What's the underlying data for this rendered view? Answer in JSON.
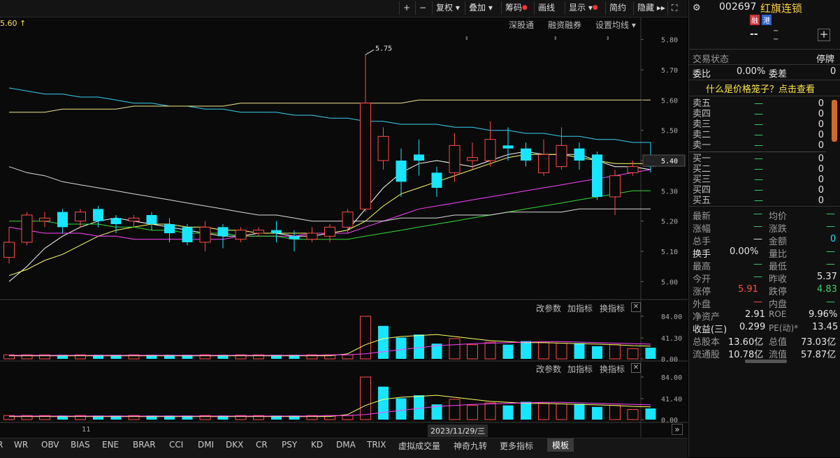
{
  "toolbar": {
    "plus": "+",
    "minus": "−",
    "fuquan": "复权",
    "diejia": "叠加",
    "chouma": "筹码",
    "huaxian": "画线",
    "xianshi": "显示",
    "jianyue": "简约",
    "yincang": "隐藏",
    "expand": "⛶"
  },
  "chart_header": {
    "price_tag": "5.60",
    "up_arrow": "↑",
    "links": [
      "深股通",
      "融资融券",
      "设置均线"
    ]
  },
  "chart_data": [
    {
      "type": "candlestick",
      "ylim": [
        4.95,
        5.85
      ],
      "yticks": [
        "5.80",
        "5.70",
        "5.60",
        "5.50",
        "5.40",
        "5.30",
        "5.20",
        "5.10",
        "5.00"
      ],
      "high_annotation": "5.75",
      "current_price": "5.40",
      "candles": [
        {
          "o": 5.08,
          "c": 5.13,
          "h": 5.18,
          "l": 5.06
        },
        {
          "o": 5.13,
          "c": 5.22,
          "h": 5.23,
          "l": 5.12
        },
        {
          "o": 5.2,
          "c": 5.21,
          "h": 5.23,
          "l": 5.18
        },
        {
          "o": 5.23,
          "c": 5.18,
          "h": 5.24,
          "l": 5.16
        },
        {
          "o": 5.2,
          "c": 5.23,
          "h": 5.24,
          "l": 5.18
        },
        {
          "o": 5.24,
          "c": 5.2,
          "h": 5.25,
          "l": 5.18
        },
        {
          "o": 5.21,
          "c": 5.19,
          "h": 5.22,
          "l": 5.16
        },
        {
          "o": 5.2,
          "c": 5.21,
          "h": 5.22,
          "l": 5.18
        },
        {
          "o": 5.22,
          "c": 5.19,
          "h": 5.23,
          "l": 5.17
        },
        {
          "o": 5.19,
          "c": 5.16,
          "h": 5.21,
          "l": 5.13
        },
        {
          "o": 5.18,
          "c": 5.13,
          "h": 5.19,
          "l": 5.12
        },
        {
          "o": 5.13,
          "c": 5.18,
          "h": 5.2,
          "l": 5.1
        },
        {
          "o": 5.18,
          "c": 5.15,
          "h": 5.19,
          "l": 5.11
        },
        {
          "o": 5.14,
          "c": 5.17,
          "h": 5.18,
          "l": 5.13
        },
        {
          "o": 5.16,
          "c": 5.17,
          "h": 5.18,
          "l": 5.15
        },
        {
          "o": 5.17,
          "c": 5.16,
          "h": 5.2,
          "l": 5.13
        },
        {
          "o": 5.15,
          "c": 5.14,
          "h": 5.17,
          "l": 5.1
        },
        {
          "o": 5.14,
          "c": 5.16,
          "h": 5.18,
          "l": 5.13
        },
        {
          "o": 5.15,
          "c": 5.18,
          "h": 5.19,
          "l": 5.13
        },
        {
          "o": 5.18,
          "c": 5.23,
          "h": 5.24,
          "l": 5.16
        },
        {
          "o": 5.24,
          "c": 5.59,
          "h": 5.75,
          "l": 5.23
        },
        {
          "o": 5.4,
          "c": 5.48,
          "h": 5.51,
          "l": 5.37
        },
        {
          "o": 5.4,
          "c": 5.33,
          "h": 5.44,
          "l": 5.28
        },
        {
          "o": 5.42,
          "c": 5.4,
          "h": 5.47,
          "l": 5.35
        },
        {
          "o": 5.36,
          "c": 5.31,
          "h": 5.38,
          "l": 5.28
        },
        {
          "o": 5.36,
          "c": 5.45,
          "h": 5.49,
          "l": 5.33
        },
        {
          "o": 5.4,
          "c": 5.41,
          "h": 5.46,
          "l": 5.37
        },
        {
          "o": 5.4,
          "c": 5.47,
          "h": 5.53,
          "l": 5.38
        },
        {
          "o": 5.45,
          "c": 5.44,
          "h": 5.51,
          "l": 5.4
        },
        {
          "o": 5.44,
          "c": 5.4,
          "h": 5.46,
          "l": 5.38
        },
        {
          "o": 5.36,
          "c": 5.42,
          "h": 5.47,
          "l": 5.35
        },
        {
          "o": 5.38,
          "c": 5.45,
          "h": 5.51,
          "l": 5.37
        },
        {
          "o": 5.44,
          "c": 5.4,
          "h": 5.46,
          "l": 5.37
        },
        {
          "o": 5.42,
          "c": 5.28,
          "h": 5.43,
          "l": 5.27
        },
        {
          "o": 5.28,
          "c": 5.35,
          "h": 5.37,
          "l": 5.22
        },
        {
          "o": 5.36,
          "c": 5.38,
          "h": 5.4,
          "l": 5.35
        },
        {
          "o": 5.41,
          "c": 5.38,
          "h": 5.46,
          "l": 5.36
        }
      ],
      "ma_lines": [
        {
          "color": "#ffffff",
          "values": [
            5.0,
            5.05,
            5.11,
            5.15,
            5.18,
            5.2,
            5.21,
            5.2,
            5.19,
            5.18,
            5.17,
            5.16,
            5.15,
            5.15,
            5.16,
            5.16,
            5.15,
            5.15,
            5.16,
            5.17,
            5.24,
            5.31,
            5.36,
            5.39,
            5.4,
            5.39,
            5.38,
            5.4,
            5.42,
            5.43,
            5.42,
            5.42,
            5.42,
            5.4,
            5.38,
            5.38,
            5.37
          ]
        },
        {
          "color": "#ffff66",
          "values": [
            5.02,
            5.04,
            5.07,
            5.09,
            5.12,
            5.15,
            5.17,
            5.18,
            5.19,
            5.19,
            5.18,
            5.18,
            5.17,
            5.17,
            5.16,
            5.16,
            5.16,
            5.16,
            5.16,
            5.17,
            5.2,
            5.25,
            5.29,
            5.31,
            5.33,
            5.35,
            5.37,
            5.39,
            5.41,
            5.42,
            5.42,
            5.42,
            5.41,
            5.4,
            5.39,
            5.39,
            5.39
          ]
        },
        {
          "color": "#ff44ff",
          "values": [
            5.18,
            5.17,
            5.16,
            5.16,
            5.16,
            5.15,
            5.15,
            5.14,
            5.14,
            5.14,
            5.14,
            5.14,
            5.14,
            5.15,
            5.15,
            5.15,
            5.15,
            5.16,
            5.16,
            5.16,
            5.18,
            5.2,
            5.22,
            5.24,
            5.25,
            5.26,
            5.27,
            5.28,
            5.29,
            5.3,
            5.31,
            5.32,
            5.33,
            5.34,
            5.35,
            5.36,
            5.37
          ]
        },
        {
          "color": "#33dd33",
          "values": [
            5.2,
            5.2,
            5.2,
            5.19,
            5.19,
            5.19,
            5.18,
            5.18,
            5.17,
            5.17,
            5.16,
            5.16,
            5.16,
            5.15,
            5.15,
            5.15,
            5.14,
            5.14,
            5.14,
            5.14,
            5.15,
            5.16,
            5.17,
            5.18,
            5.19,
            5.2,
            5.21,
            5.22,
            5.23,
            5.24,
            5.25,
            5.26,
            5.27,
            5.28,
            5.29,
            5.3,
            5.3
          ]
        },
        {
          "color": "#dddddd",
          "values": [
            5.38,
            5.36,
            5.35,
            5.33,
            5.32,
            5.31,
            5.3,
            5.29,
            5.28,
            5.27,
            5.26,
            5.25,
            5.24,
            5.23,
            5.22,
            5.22,
            5.21,
            5.2,
            5.2,
            5.2,
            5.2,
            5.2,
            5.21,
            5.21,
            5.21,
            5.22,
            5.22,
            5.22,
            5.23,
            5.23,
            5.23,
            5.23,
            5.24,
            5.24,
            5.24,
            5.24,
            5.24
          ]
        },
        {
          "color": "#3ad0f0",
          "values": [
            5.64,
            5.63,
            5.62,
            5.62,
            5.61,
            5.61,
            5.6,
            5.59,
            5.59,
            5.58,
            5.58,
            5.57,
            5.57,
            5.56,
            5.56,
            5.56,
            5.55,
            5.55,
            5.54,
            5.54,
            5.53,
            5.53,
            5.52,
            5.52,
            5.52,
            5.51,
            5.51,
            5.5,
            5.5,
            5.49,
            5.49,
            5.48,
            5.48,
            5.47,
            5.47,
            5.46,
            5.46
          ]
        },
        {
          "color": "#f0e68c",
          "values": [
            5.56,
            5.56,
            5.56,
            5.57,
            5.57,
            5.57,
            5.57,
            5.58,
            5.58,
            5.58,
            5.58,
            5.58,
            5.58,
            5.59,
            5.59,
            5.59,
            5.59,
            5.59,
            5.59,
            5.59,
            5.59,
            5.59,
            5.59,
            5.6,
            5.6,
            5.6,
            5.6,
            5.6,
            5.6,
            5.6,
            5.6,
            5.6,
            5.6,
            5.6,
            5.6,
            5.6,
            5.6
          ]
        }
      ]
    },
    {
      "type": "bar",
      "panel": "volume",
      "yticks": [
        "84.00",
        "41.30",
        "0.00"
      ],
      "ylim": [
        0,
        84
      ],
      "values": [
        8,
        8,
        8,
        8,
        8,
        8,
        8,
        8,
        8,
        8,
        8,
        8,
        8,
        8,
        8,
        8,
        8,
        8,
        8,
        8,
        84,
        65,
        42,
        48,
        30,
        40,
        28,
        33,
        28,
        35,
        32,
        31,
        31,
        25,
        28,
        20,
        22
      ],
      "rising": [
        true,
        true,
        true,
        false,
        true,
        false,
        false,
        true,
        false,
        false,
        false,
        true,
        false,
        true,
        true,
        false,
        false,
        true,
        true,
        true,
        true,
        false,
        false,
        false,
        false,
        true,
        true,
        true,
        false,
        false,
        true,
        true,
        false,
        false,
        true,
        true,
        false
      ],
      "lines": [
        {
          "color": "#ffff66",
          "values": [
            6,
            6,
            6,
            6,
            6,
            6,
            6,
            6,
            6,
            6,
            6,
            6,
            6,
            6,
            6,
            6,
            6,
            6,
            6,
            10,
            28,
            40,
            44,
            46,
            48,
            44,
            40,
            36,
            34,
            32,
            32,
            31,
            30,
            29,
            28,
            26,
            25
          ]
        },
        {
          "color": "#ff44ff",
          "values": [
            7,
            7,
            7,
            7,
            7,
            7,
            7,
            7,
            7,
            7,
            7,
            7,
            7,
            7,
            7,
            7,
            7,
            7,
            8,
            8,
            10,
            14,
            18,
            22,
            26,
            28,
            30,
            31,
            32,
            33,
            34,
            34,
            33,
            32,
            31,
            30,
            29
          ]
        }
      ]
    },
    {
      "type": "bar",
      "panel": "indicator",
      "yticks": [
        "84.00",
        "41.40",
        "0.00"
      ],
      "ylim": [
        0,
        84
      ],
      "values": [
        8,
        8,
        8,
        8,
        8,
        8,
        8,
        8,
        8,
        8,
        8,
        8,
        8,
        8,
        8,
        8,
        8,
        8,
        8,
        8,
        84,
        65,
        42,
        48,
        30,
        40,
        28,
        33,
        28,
        35,
        32,
        31,
        31,
        25,
        28,
        20,
        22
      ],
      "rising": [
        true,
        true,
        true,
        false,
        true,
        false,
        false,
        true,
        false,
        false,
        false,
        true,
        false,
        true,
        true,
        false,
        false,
        true,
        true,
        true,
        true,
        false,
        false,
        false,
        false,
        true,
        true,
        true,
        false,
        false,
        true,
        true,
        false,
        false,
        true,
        true,
        false
      ],
      "lines": [
        {
          "color": "#ffff66",
          "values": [
            6,
            6,
            6,
            6,
            6,
            6,
            6,
            6,
            6,
            6,
            6,
            6,
            6,
            6,
            6,
            6,
            6,
            6,
            6,
            10,
            28,
            40,
            44,
            46,
            48,
            44,
            40,
            36,
            34,
            32,
            32,
            31,
            30,
            29,
            28,
            26,
            25
          ]
        },
        {
          "color": "#ff44ff",
          "values": [
            7,
            7,
            7,
            7,
            7,
            7,
            7,
            7,
            7,
            7,
            7,
            7,
            7,
            7,
            7,
            7,
            7,
            7,
            8,
            8,
            10,
            14,
            18,
            22,
            26,
            28,
            30,
            31,
            32,
            33,
            34,
            34,
            33,
            32,
            31,
            30,
            29
          ]
        }
      ]
    }
  ],
  "panel_controls": {
    "change_param": "改参数",
    "add_indicator": "加指标",
    "switch_indicator": "换指标",
    "close": "✕"
  },
  "xaxis": {
    "left_label": "11",
    "date_label": "2023/11/29/三",
    "scroll": "»"
  },
  "indicator_tabs": [
    "R",
    "WR",
    "OBV",
    "BIAS",
    "ENE",
    "BRAR",
    "CCI",
    "DMI",
    "DKX",
    "CR",
    "PSY",
    "KD",
    "DMA",
    "TRIX",
    "虚拟成交量",
    "神奇九转",
    "更多指标",
    "模板"
  ],
  "stock": {
    "code": "002697",
    "name": "红旗连锁",
    "tag1": "融",
    "tag2": "港",
    "price": "--",
    "change": "−",
    "change_pct": "−",
    "add": "+",
    "status_label": "交易状态",
    "status": "停牌",
    "weibi_label": "委比",
    "weibi": "0.00%",
    "weicha_label": "委差",
    "weicha": "0",
    "promo": "什么是价格笼子？点击查看"
  },
  "orderbook": {
    "asks": [
      {
        "label": "卖五",
        "price": "—",
        "vol": "0"
      },
      {
        "label": "卖四",
        "price": "—",
        "vol": "0"
      },
      {
        "label": "卖三",
        "price": "—",
        "vol": "0"
      },
      {
        "label": "卖二",
        "price": "—",
        "vol": "0"
      },
      {
        "label": "卖一",
        "price": "—",
        "vol": "0"
      }
    ],
    "bids": [
      {
        "label": "买一",
        "price": "—",
        "vol": "0"
      },
      {
        "label": "买二",
        "price": "—",
        "vol": "0"
      },
      {
        "label": "买三",
        "price": "—",
        "vol": "0"
      },
      {
        "label": "买四",
        "price": "—",
        "vol": "0"
      },
      {
        "label": "买五",
        "price": "—",
        "vol": "0"
      }
    ]
  },
  "quote": {
    "zuixin": "最新",
    "zuixin_v": "—",
    "junjia": "均价",
    "junjia_v": "—",
    "zhangfu": "涨幅",
    "zhangfu_v": "—",
    "zhangdie": "涨跌",
    "zhangdie_v": "—",
    "zongshou": "总手",
    "zongshou_v": "—",
    "jine": "金额",
    "jine_v": "0",
    "huanshou": "换手",
    "huanshou_v": "0.00%",
    "liangbi": "量比",
    "liangbi_v": "—",
    "zuigao": "最高",
    "zuigao_v": "—",
    "zuidi": "最低",
    "zuidi_v": "—",
    "jinkai": "今开",
    "jinkai_v": "—",
    "zuoshou": "昨收",
    "zuoshou_v": "5.37",
    "zhangting": "涨停",
    "zhangting_v": "5.91",
    "dieting": "跌停",
    "dieting_v": "4.83",
    "waipan": "外盘",
    "waipan_v": "—",
    "neipan": "内盘",
    "neipan_v": "—",
    "jingzichan": "净资产",
    "jingzichan_v": "2.91",
    "roe": "ROE",
    "roe_v": "9.96%",
    "shouyi": "收益(三)",
    "shouyi_v": "0.299",
    "pe": "PE(动)*",
    "pe_v": "13.45",
    "zongguben": "总股本",
    "zongguben_v": "13.60亿",
    "zongzhi": "总值",
    "zongzhi_v": "73.03亿",
    "liutonggu": "流通股",
    "liutonggu_v": "10.78亿",
    "liuzhi": "流值",
    "liuzhi_v": "57.87亿"
  }
}
